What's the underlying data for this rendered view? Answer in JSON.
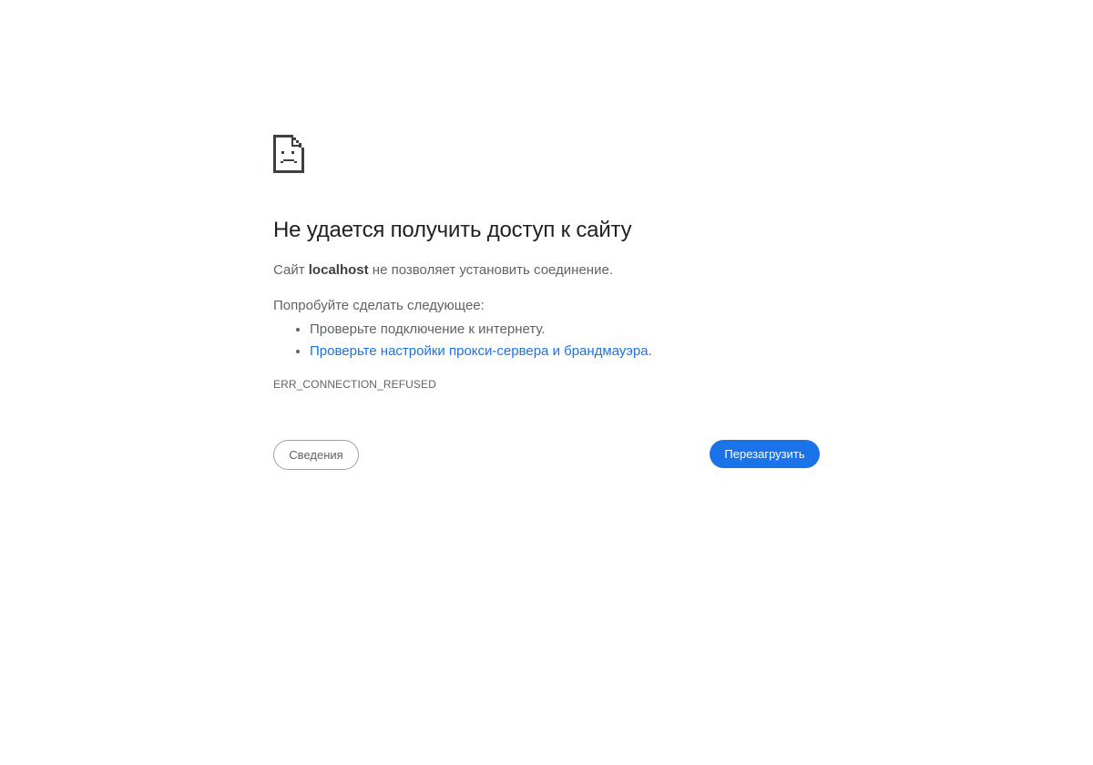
{
  "main": {
    "icon": "sad-page-icon",
    "title": "Не удается получить доступ к сайту",
    "summary": {
      "prefix": "Сайт ",
      "host": "localhost",
      "suffix": " не позволяет установить соединение."
    },
    "suggestions_heading": "Попробуйте сделать следующее:",
    "suggestions": [
      {
        "text": "Проверьте подключение к интернету."
      },
      {
        "link_text": "Проверьте настройки прокси-сервера и брандмауэра",
        "suffix": "."
      }
    ],
    "error_code": "ERR_CONNECTION_REFUSED"
  },
  "buttons": {
    "details_label": "Сведения",
    "reload_label": "Перезагрузить"
  },
  "colors": {
    "accent": "#1a73e8",
    "title_text": "#202124",
    "body_text": "#5f6368",
    "icon": "#3c4043"
  }
}
